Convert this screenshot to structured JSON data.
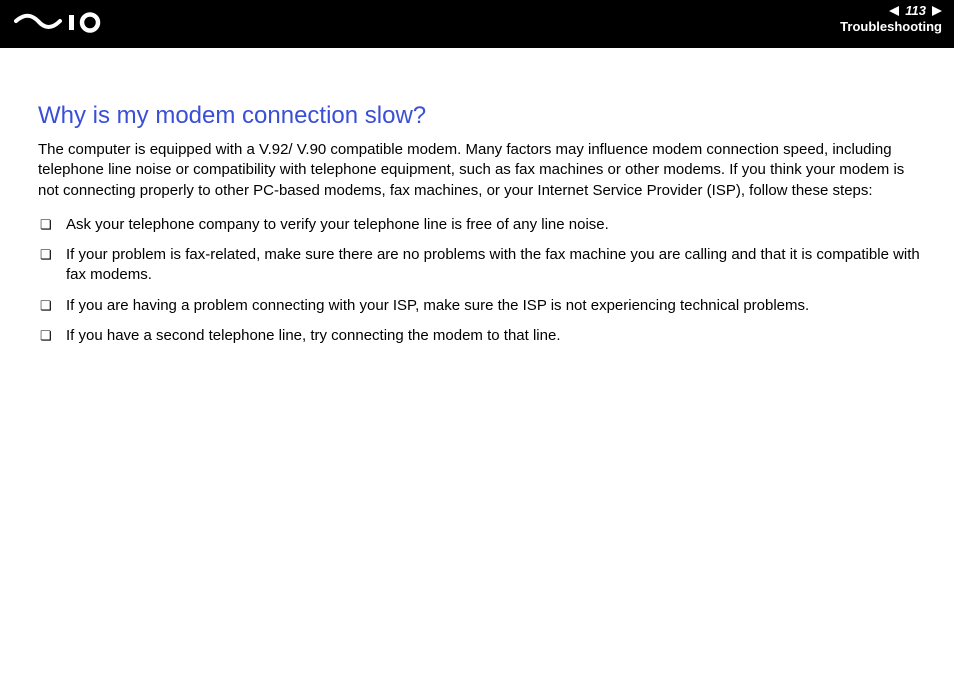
{
  "header": {
    "page_number": "113",
    "section": "Troubleshooting"
  },
  "title": "Why is my modem connection slow?",
  "intro": "The computer is equipped with a V.92/ V.90 compatible modem. Many factors may influence modem connection speed, including telephone line noise or compatibility with telephone equipment, such as fax machines or other modems. If you think your modem is not connecting properly to other PC-based modems, fax machines, or your Internet Service Provider (ISP), follow these steps:",
  "steps": [
    "Ask your telephone company to verify your telephone line is free of any line noise.",
    "If your problem is fax-related, make sure there are no problems with the fax machine you are calling and that it is compatible with fax modems.",
    "If you are having a problem connecting with your ISP, make sure the ISP is not experiencing technical problems.",
    "If you have a second telephone line, try connecting the modem to that line."
  ]
}
